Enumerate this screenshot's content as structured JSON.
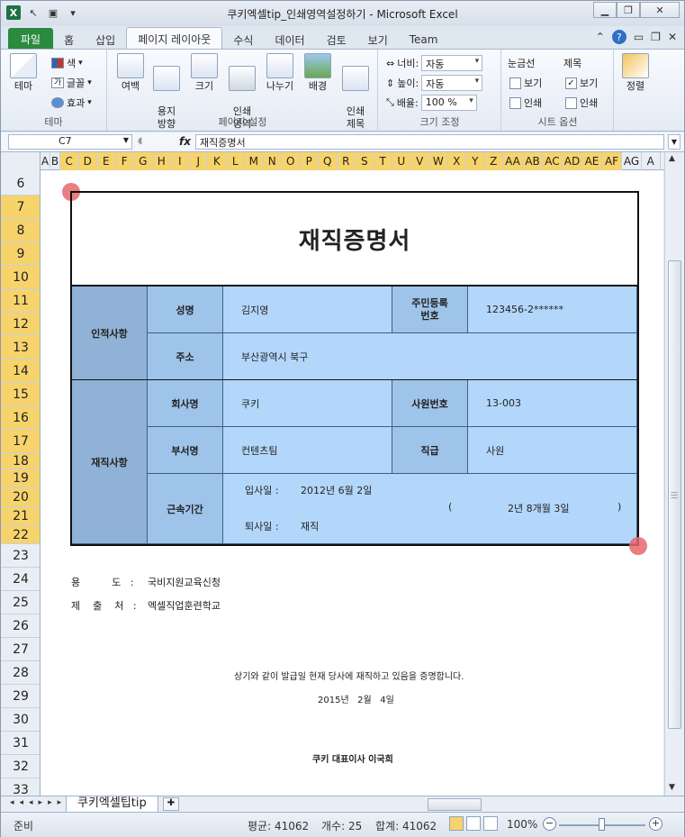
{
  "window": {
    "title": "쿠키엑셀tip_인쇄영역설정하기  -  Microsoft Excel",
    "app_icon": "X",
    "controls": [
      "minimize",
      "restore",
      "close"
    ]
  },
  "ribbon_tabs": {
    "file": "파일",
    "items": [
      "홈",
      "삽입",
      "페이지 레이아웃",
      "수식",
      "데이터",
      "검토",
      "보기",
      "Team"
    ],
    "active": "페이지 레이아웃"
  },
  "ribbon": {
    "theme_group": {
      "label": "테마",
      "theme_btn": "테마",
      "colors": "색",
      "fonts": "글꼴",
      "effects": "효과"
    },
    "page_setup_group": {
      "label": "페이지 설정",
      "margins": "여백",
      "orientation": "용지\n방향",
      "size": "크기",
      "print_area": "인쇄\n영역",
      "breaks": "나누기",
      "background": "배경",
      "print_titles": "인쇄\n제목"
    },
    "scale_group": {
      "label": "크기 조정",
      "width_label": "너비:",
      "width_value": "자동",
      "height_label": "높이:",
      "height_value": "자동",
      "scale_label": "배율:",
      "scale_value": "100 %"
    },
    "sheet_options_group": {
      "label": "시트 옵션",
      "gridlines": "눈금선",
      "headings": "제목",
      "view": "보기",
      "print": "인쇄"
    },
    "arrange_group": {
      "arrange": "정렬"
    }
  },
  "formula_bar": {
    "name_box": "C7",
    "fx": "fx",
    "content": "재직증명서"
  },
  "columns": [
    "A",
    "B",
    "C",
    "D",
    "E",
    "F",
    "G",
    "H",
    "I",
    "J",
    "K",
    "L",
    "M",
    "N",
    "O",
    "P",
    "Q",
    "R",
    "S",
    "T",
    "U",
    "V",
    "W",
    "X",
    "Y",
    "Z",
    "AA",
    "AB",
    "AC",
    "AD",
    "AE",
    "AF",
    "AG",
    "A"
  ],
  "rows": [
    "6",
    "7",
    "8",
    "9",
    "10",
    "11",
    "12",
    "13",
    "14",
    "15",
    "16",
    "17",
    "18",
    "19",
    "20",
    "21",
    "22",
    "23",
    "24",
    "25",
    "26",
    "27",
    "28",
    "29",
    "30",
    "31",
    "32",
    "33"
  ],
  "document": {
    "title": "재직증명서",
    "personal": {
      "section": "인적사항",
      "name_label": "성명",
      "name": "김지영",
      "id_label": "주민등록\n번호",
      "id": "123456-2******",
      "address_label": "주소",
      "address": "부산광역시 북구"
    },
    "employment": {
      "section": "재직사항",
      "company_label": "회사명",
      "company": "쿠키",
      "emp_no_label": "사원번호",
      "emp_no": "13-003",
      "dept_label": "부서명",
      "dept": "컨텐츠팀",
      "rank_label": "직급",
      "rank": "사원",
      "tenure_label": "근속기간",
      "join_label": "입사일 :",
      "join_date": "2012년 6월 2일",
      "leave_label": "퇴사일 :",
      "leave_value": "재직",
      "paren_open": "(",
      "duration": "2년 8개월 3일",
      "paren_close": ")"
    },
    "purpose_label": "용          도   :",
    "purpose": "국비지원교육신청",
    "submit_label": "제    출    처   :",
    "submit_to": "엑셀직업훈련학교",
    "statement": "상기와 같이 발급일 현재 당사에 재직하고 있음을 증명합니다.",
    "issue_date": "2015년   2월   4일",
    "signature": "쿠키 대표이사 이국희"
  },
  "sheet_tabs": {
    "active": "쿠키엑셀팁tip"
  },
  "status_bar": {
    "ready": "준비",
    "average": "평균: 41062",
    "count": "개수: 25",
    "sum": "합계: 41062",
    "zoom": "100%"
  }
}
